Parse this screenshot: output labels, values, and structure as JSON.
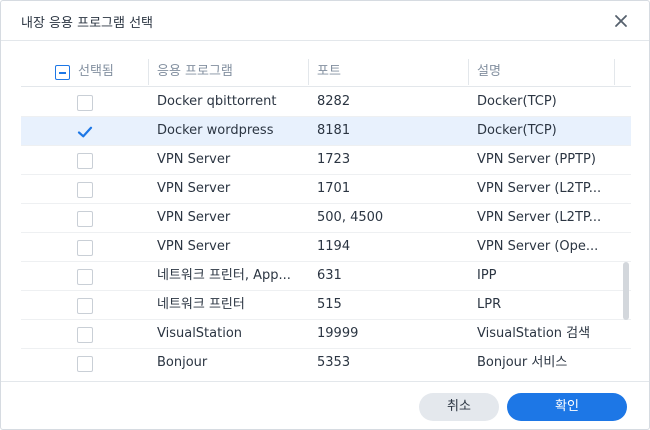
{
  "dialog": {
    "title": "내장 응용 프로그램 선택",
    "close_icon": "close-icon"
  },
  "table": {
    "columns": {
      "selected": "선택됨",
      "application": "응용 프로그램",
      "port": "포트",
      "description": "설명"
    },
    "header_checkbox_state": "partial",
    "rows": [
      {
        "checked": false,
        "application": "Docker qbittorrent",
        "port": "8282",
        "description": "Docker(TCP)"
      },
      {
        "checked": true,
        "application": "Docker wordpress",
        "port": "8181",
        "description": "Docker(TCP)"
      },
      {
        "checked": false,
        "application": "VPN Server",
        "port": "1723",
        "description": "VPN Server (PPTP)"
      },
      {
        "checked": false,
        "application": "VPN Server",
        "port": "1701",
        "description": "VPN Server (L2TP..."
      },
      {
        "checked": false,
        "application": "VPN Server",
        "port": "500, 4500",
        "description": "VPN Server (L2TP..."
      },
      {
        "checked": false,
        "application": "VPN Server",
        "port": "1194",
        "description": "VPN Server (Ope..."
      },
      {
        "checked": false,
        "application": "네트워크 프린터, App...",
        "port": "631",
        "description": "IPP"
      },
      {
        "checked": false,
        "application": "네트워크 프린터",
        "port": "515",
        "description": "LPR"
      },
      {
        "checked": false,
        "application": "VisualStation",
        "port": "19999",
        "description": "VisualStation 검색"
      },
      {
        "checked": false,
        "application": "Bonjour",
        "port": "5353",
        "description": "Bonjour 서비스"
      }
    ]
  },
  "footer": {
    "cancel_label": "취소",
    "ok_label": "확인"
  },
  "colors": {
    "accent": "#1d77e6",
    "selected_row": "#e8f1fd",
    "cancel_bg": "#e4e8ed"
  }
}
